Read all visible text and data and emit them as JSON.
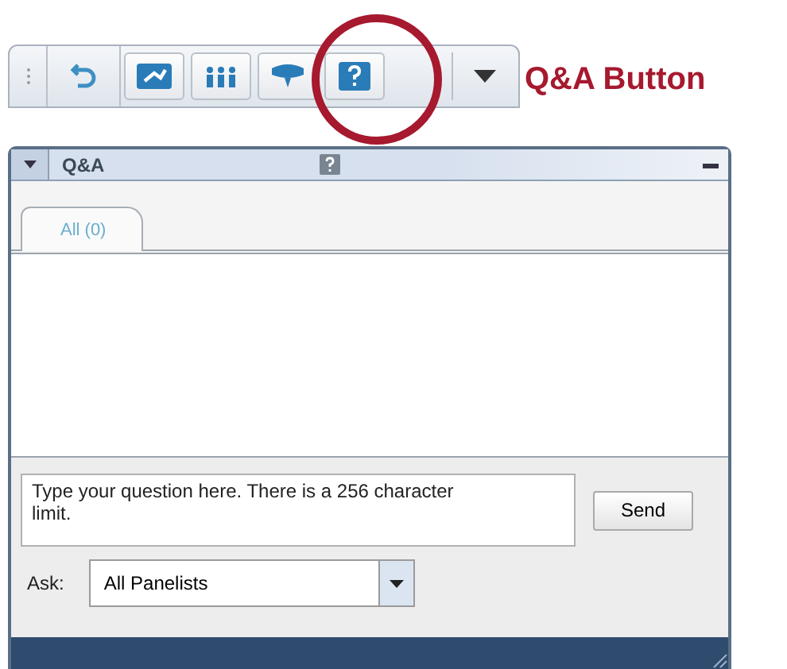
{
  "toolbar": {
    "annotation": "Q&A Button"
  },
  "panel": {
    "title": "Q&A",
    "tabs": [
      {
        "label": "All (0)",
        "selected": true
      }
    ],
    "question": {
      "placeholder": "Type your question here. There is a 256 character limit."
    },
    "send_button": "Send",
    "ask": {
      "label": "Ask:",
      "value": "All Panelists"
    }
  }
}
